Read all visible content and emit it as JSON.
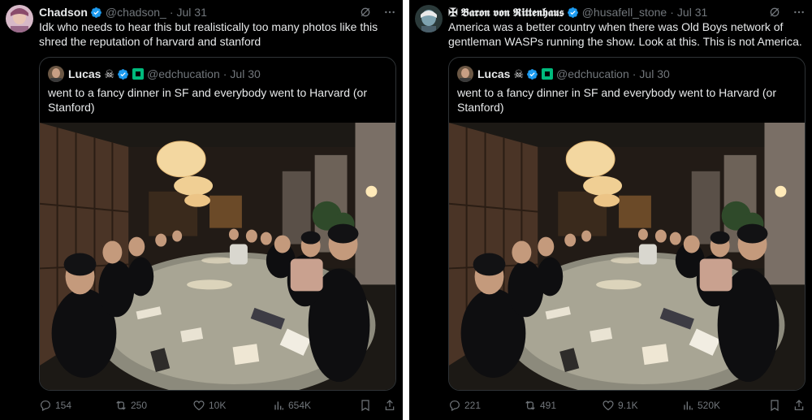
{
  "posts": [
    {
      "author": {
        "name": "Chadson",
        "handle": "@chadson_",
        "date": "Jul 31"
      },
      "text": "Idk who needs to hear this but realistically too many photos like this shred the reputation of harvard and stanford",
      "quoted": {
        "author": {
          "name": "Lucas",
          "emoji": "☠",
          "handle": "@edchucation",
          "date": "Jul 30"
        },
        "text": "went to a fancy dinner in SF and everybody went to Harvard (or Stanford)"
      },
      "actions": {
        "replies": "154",
        "reposts": "250",
        "likes": "10K",
        "views": "654K"
      }
    },
    {
      "author": {
        "name": "✠ 𝕭𝖆𝖗𝖔𝖓 𝖛𝖔𝖓 𝕽𝖎𝖙𝖙𝖊𝖓𝖍𝖆𝖚𝖘",
        "handle": "@husafell_stone",
        "date": "Jul 31"
      },
      "text": "America was a better country when there was Old Boys network of gentleman WASPs running the show. Look at this. This is not America.",
      "quoted": {
        "author": {
          "name": "Lucas",
          "emoji": "☠",
          "handle": "@edchucation",
          "date": "Jul 30"
        },
        "text": "went to a fancy dinner in SF and everybody went to Harvard (or Stanford)"
      },
      "actions": {
        "replies": "221",
        "reposts": "491",
        "likes": "9.1K",
        "views": "520K"
      }
    }
  ],
  "icons": {
    "verified": "verified-badge-icon",
    "grok": "grok-icon",
    "more": "more-icon",
    "reply": "reply-icon",
    "repost": "repost-icon",
    "like": "like-icon",
    "views": "views-icon",
    "bookmark": "bookmark-icon",
    "share": "share-icon"
  },
  "colors": {
    "background": "#000000",
    "text": "#e7e9ea",
    "muted": "#71767b",
    "verified": "#1d9bf0",
    "border": "#2f3336"
  }
}
